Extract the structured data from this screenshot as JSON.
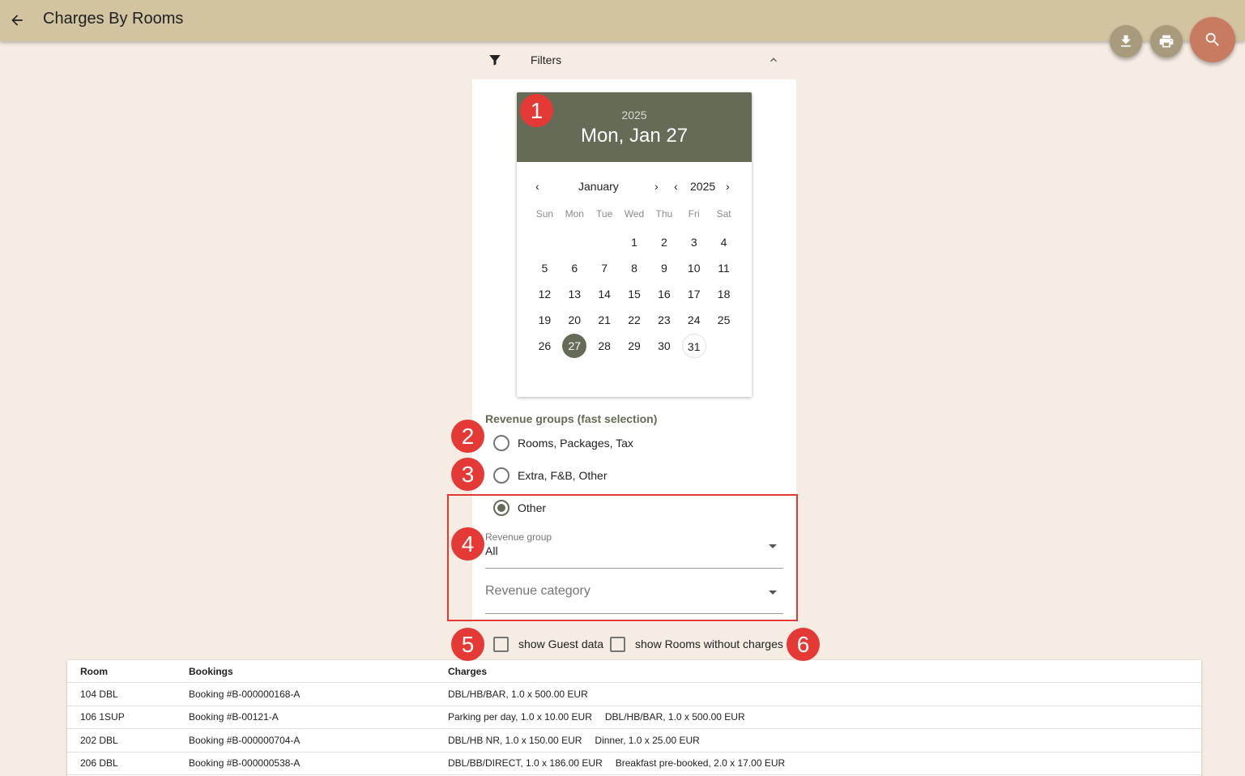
{
  "app": {
    "title": "Charges By Rooms"
  },
  "toolbar": {
    "back": "back-arrow-icon",
    "download": "download-icon",
    "print": "print-icon",
    "search": "search-icon"
  },
  "filters": {
    "label": "Filters",
    "datepicker": {
      "year": "2025",
      "date_label": "Mon, Jan 27",
      "month": "January",
      "nav_year": "2025",
      "weekdays": [
        "Sun",
        "Mon",
        "Tue",
        "Wed",
        "Thu",
        "Fri",
        "Sat"
      ],
      "leading_blanks": 3,
      "days": [
        "1",
        "2",
        "3",
        "4",
        "5",
        "6",
        "7",
        "8",
        "9",
        "10",
        "11",
        "12",
        "13",
        "14",
        "15",
        "16",
        "17",
        "18",
        "19",
        "20",
        "21",
        "22",
        "23",
        "24",
        "25",
        "26",
        "27",
        "28",
        "29",
        "30",
        "31"
      ],
      "selected_day": "27",
      "today_day": "31"
    },
    "revenue_groups_title": "Revenue groups (fast selection)",
    "radios": [
      {
        "label": "Rooms, Packages, Tax",
        "checked": false
      },
      {
        "label": "Extra, F&B, Other",
        "checked": false
      },
      {
        "label": "Other",
        "checked": true
      }
    ],
    "revenue_group": {
      "label": "Revenue group",
      "value": "All"
    },
    "revenue_category": {
      "placeholder": "Revenue category"
    },
    "checkboxes": {
      "guest_data": "show Guest data",
      "rooms_without_charges": "show Rooms without charges"
    }
  },
  "markers": [
    "1",
    "2",
    "3",
    "4",
    "5",
    "6"
  ],
  "table": {
    "headers": {
      "room": "Room",
      "bookings": "Bookings",
      "charges": "Charges"
    },
    "rows": [
      {
        "room": "104 DBL",
        "booking": "Booking #B-000000168-A",
        "charges": [
          "DBL/HB/BAR, 1.0 x 500.00 EUR"
        ]
      },
      {
        "room": "106 1SUP",
        "booking": "Booking #B-00121-A",
        "charges": [
          "Parking per day, 1.0 x 10.00 EUR",
          "DBL/HB/BAR, 1.0 x 500.00 EUR"
        ]
      },
      {
        "room": "202 DBL",
        "booking": "Booking #B-000000704-A",
        "charges": [
          "DBL/HB NR, 1.0 x 150.00 EUR",
          "Dinner, 1.0 x 25.00 EUR"
        ]
      },
      {
        "room": "206 DBL",
        "booking": "Booking #B-000000538-A",
        "charges": [
          "DBL/BB/DIRECT, 1.0 x 186.00 EUR",
          "Breakfast pre-booked, 2.0 x 17.00 EUR"
        ]
      }
    ]
  }
}
